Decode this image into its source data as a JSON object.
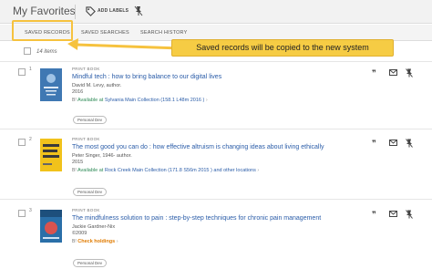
{
  "header": {
    "title": "My Favorites",
    "add_labels": "ADD LABELS"
  },
  "tabs": [
    "SAVED RECORDS",
    "SAVED SEARCHES",
    "SEARCH HISTORY"
  ],
  "callout": "Saved records will be copied to the new system",
  "count_text": "14 items",
  "records": [
    {
      "num": "1",
      "type": "PRINT BOOK",
      "title": "Mindful tech : how to bring balance to our digital lives",
      "author": "David M. Levy, author.",
      "year": "2016",
      "avail_status": "Available at",
      "avail_location": "Sylvania",
      "avail_collection": "Main Collection (158.1 L48m 2016 )",
      "other": "",
      "label": "Personal Dev",
      "cover_color": "#3f78b3"
    },
    {
      "num": "2",
      "type": "PRINT BOOK",
      "title": "The most good you can do : how effective altruism is changing ideas about living ethically",
      "author": "Peter Singer, 1946- author.",
      "year": "2015",
      "avail_status": "Available at",
      "avail_location": "Rock Creek",
      "avail_collection": "Main Collection (171.8 S56m 2015 )",
      "other": "and other locations",
      "label": "Personal Dev",
      "cover_color": "#f1c21b"
    },
    {
      "num": "3",
      "type": "PRINT BOOK",
      "title": "The mindfulness solution to pain : step-by-step techniques for chronic pain management",
      "author": "Jackie Gardner-Nix",
      "year": "©2009",
      "avail_status": "Check holdings",
      "avail_location": "",
      "avail_collection": "",
      "other": "",
      "label": "Personal Dev",
      "cover_color": "#2a6fa8"
    }
  ],
  "colors": {
    "accent": "#f6cc44",
    "link": "#2a5ca8",
    "available": "#2e8b57",
    "check": "#e07b00"
  },
  "icons": [
    "tag-icon",
    "pin-icon",
    "quote-icon",
    "email-icon",
    "chevron-right-icon"
  ]
}
